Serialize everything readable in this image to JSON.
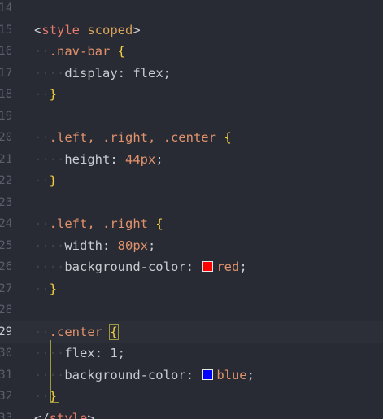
{
  "editor": {
    "active_line": "29",
    "lines": [
      {
        "num": "14",
        "text": ""
      },
      {
        "num": "15",
        "open": "<",
        "tag": "style",
        "attr": "scoped",
        "close": ">"
      },
      {
        "num": "16",
        "selector": ".nav-bar",
        "brace": "{"
      },
      {
        "num": "17",
        "prop": "display",
        "value": "flex"
      },
      {
        "num": "18",
        "brace": "}"
      },
      {
        "num": "19",
        "text": ""
      },
      {
        "num": "20",
        "selector": ".left, .right, .center",
        "brace": "{"
      },
      {
        "num": "21",
        "prop": "height",
        "value": "44px"
      },
      {
        "num": "22",
        "brace": "}"
      },
      {
        "num": "23",
        "text": ""
      },
      {
        "num": "24",
        "selector": ".left, .right",
        "brace": "{"
      },
      {
        "num": "25",
        "prop": "width",
        "value": "80px"
      },
      {
        "num": "26",
        "prop": "background-color",
        "value": "red",
        "swatch": "#ff0000"
      },
      {
        "num": "27",
        "brace": "}"
      },
      {
        "num": "28",
        "text": ""
      },
      {
        "num": "29",
        "selector": ".center",
        "brace": "{"
      },
      {
        "num": "30",
        "prop": "flex",
        "value": "1"
      },
      {
        "num": "31",
        "prop": "background-color",
        "value": "blue",
        "swatch": "#0000ff"
      },
      {
        "num": "32",
        "brace": "}"
      },
      {
        "num": "33",
        "open": "</",
        "tag": "style",
        "close": ">"
      }
    ]
  }
}
